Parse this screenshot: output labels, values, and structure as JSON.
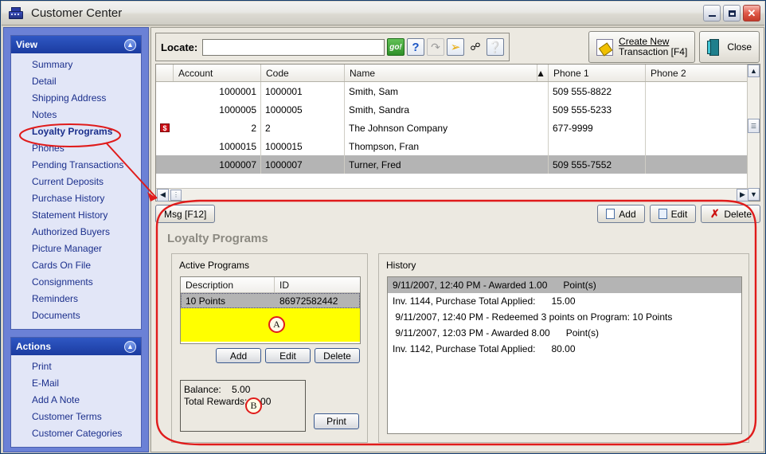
{
  "window": {
    "title": "Customer Center",
    "icon": "cash-register-icon",
    "minimize": "_",
    "maximize": "□",
    "close": "✕"
  },
  "sidebar": {
    "view": {
      "header": "View",
      "collapse_icon": "chevron-up-icon",
      "items": [
        {
          "label": "Summary",
          "active": false
        },
        {
          "label": "Detail",
          "active": false
        },
        {
          "label": "Shipping Address",
          "active": false
        },
        {
          "label": "Notes",
          "active": false
        },
        {
          "label": "Loyalty Programs",
          "active": true
        },
        {
          "label": "Phones",
          "active": false
        },
        {
          "label": "Pending Transactions",
          "active": false
        },
        {
          "label": "Current Deposits",
          "active": false
        },
        {
          "label": "Purchase History",
          "active": false
        },
        {
          "label": "Statement History",
          "active": false
        },
        {
          "label": "Authorized Buyers",
          "active": false
        },
        {
          "label": "Picture Manager",
          "active": false
        },
        {
          "label": "Cards On File",
          "active": false
        },
        {
          "label": "Consignments",
          "active": false
        },
        {
          "label": "Reminders",
          "active": false
        },
        {
          "label": "Documents",
          "active": false
        }
      ]
    },
    "actions": {
      "header": "Actions",
      "collapse_icon": "chevron-up-icon",
      "items": [
        {
          "label": "Print"
        },
        {
          "label": "E-Mail"
        },
        {
          "label": "Add A Note"
        },
        {
          "label": "Customer Terms"
        },
        {
          "label": "Customer Categories"
        }
      ]
    }
  },
  "toolbar": {
    "locate_label": "Locate:",
    "locate_value": "",
    "locate_placeholder": "",
    "buttons": [
      {
        "name": "go-button",
        "label": "go!"
      },
      {
        "name": "question-button",
        "label": "?"
      },
      {
        "name": "refresh-button",
        "label": "↻"
      },
      {
        "name": "jump-arrow-button",
        "label": "↰"
      },
      {
        "name": "binoculars-button",
        "label": "🔍"
      },
      {
        "name": "help-button",
        "label": "?"
      }
    ],
    "create_new_transaction": {
      "line1": "Create New",
      "line2": "Transaction [F4]"
    },
    "close_label": "Close"
  },
  "grid": {
    "columns": [
      "Account",
      "Code",
      "Name",
      "Phone 1",
      "Phone 2"
    ],
    "sort_indicator": "▲",
    "rows": [
      {
        "flag": "",
        "account": "1000001",
        "code": "1000001",
        "name": "Smith, Sam",
        "phone1": "509  555-8822",
        "phone2": "",
        "selected": false
      },
      {
        "flag": "",
        "account": "1000005",
        "code": "1000005",
        "name": "Smith, Sandra",
        "phone1": "509  555-5233",
        "phone2": "",
        "selected": false
      },
      {
        "flag": "$",
        "account": "2",
        "code": "2",
        "name": "The Johnson Company",
        "phone1": " 677-9999",
        "phone2": "",
        "selected": false
      },
      {
        "flag": "",
        "account": "1000015",
        "code": "1000015",
        "name": "Thompson, Fran",
        "phone1": "",
        "phone2": "",
        "selected": false
      },
      {
        "flag": "",
        "account": "1000007",
        "code": "1000007",
        "name": "Turner, Fred",
        "phone1": "509  555-7552",
        "phone2": "",
        "selected": true
      }
    ]
  },
  "action_row": {
    "msg_label": "Msg [F12]",
    "add_label": "Add",
    "edit_label": "Edit",
    "delete_label": "Delete"
  },
  "loyalty": {
    "title": "Loyalty Programs",
    "active_programs": {
      "label": "Active Programs",
      "columns": [
        "Description",
        "ID"
      ],
      "rows": [
        {
          "description": "10 Points",
          "id": "86972582442",
          "selected": true
        }
      ],
      "add_label": "Add",
      "edit_label": "Edit",
      "delete_label": "Delete"
    },
    "balance": {
      "balance_label": "Balance:",
      "balance_value": "5.00",
      "rewards_label": "Total Rewards:",
      "rewards_value": "6.00"
    },
    "print_label": "Print",
    "history": {
      "label": "History",
      "items": [
        {
          "text": "9/11/2007, 12:40 PM - Awarded 1.00      Point(s)",
          "selected": true
        },
        {
          "text": "Inv. 1144, Purchase Total Applied:      15.00",
          "selected": false
        },
        {
          "text": " 9/11/2007, 12:40 PM - Redeemed 3 points on Program: 10 Points",
          "selected": false
        },
        {
          "text": " 9/11/2007, 12:03 PM - Awarded 8.00      Point(s)",
          "selected": false
        },
        {
          "text": "Inv. 1142, Purchase Total Applied:      80.00",
          "selected": false
        }
      ]
    }
  },
  "annotations": {
    "color": "#e01b1b",
    "markers": [
      {
        "label": "A",
        "target": "active-programs-buttons"
      },
      {
        "label": "B",
        "target": "balance-box"
      }
    ],
    "highlight_ellipse": "loyalty-programs-nav-item",
    "highlight_region": "loyalty-programs-panel"
  }
}
